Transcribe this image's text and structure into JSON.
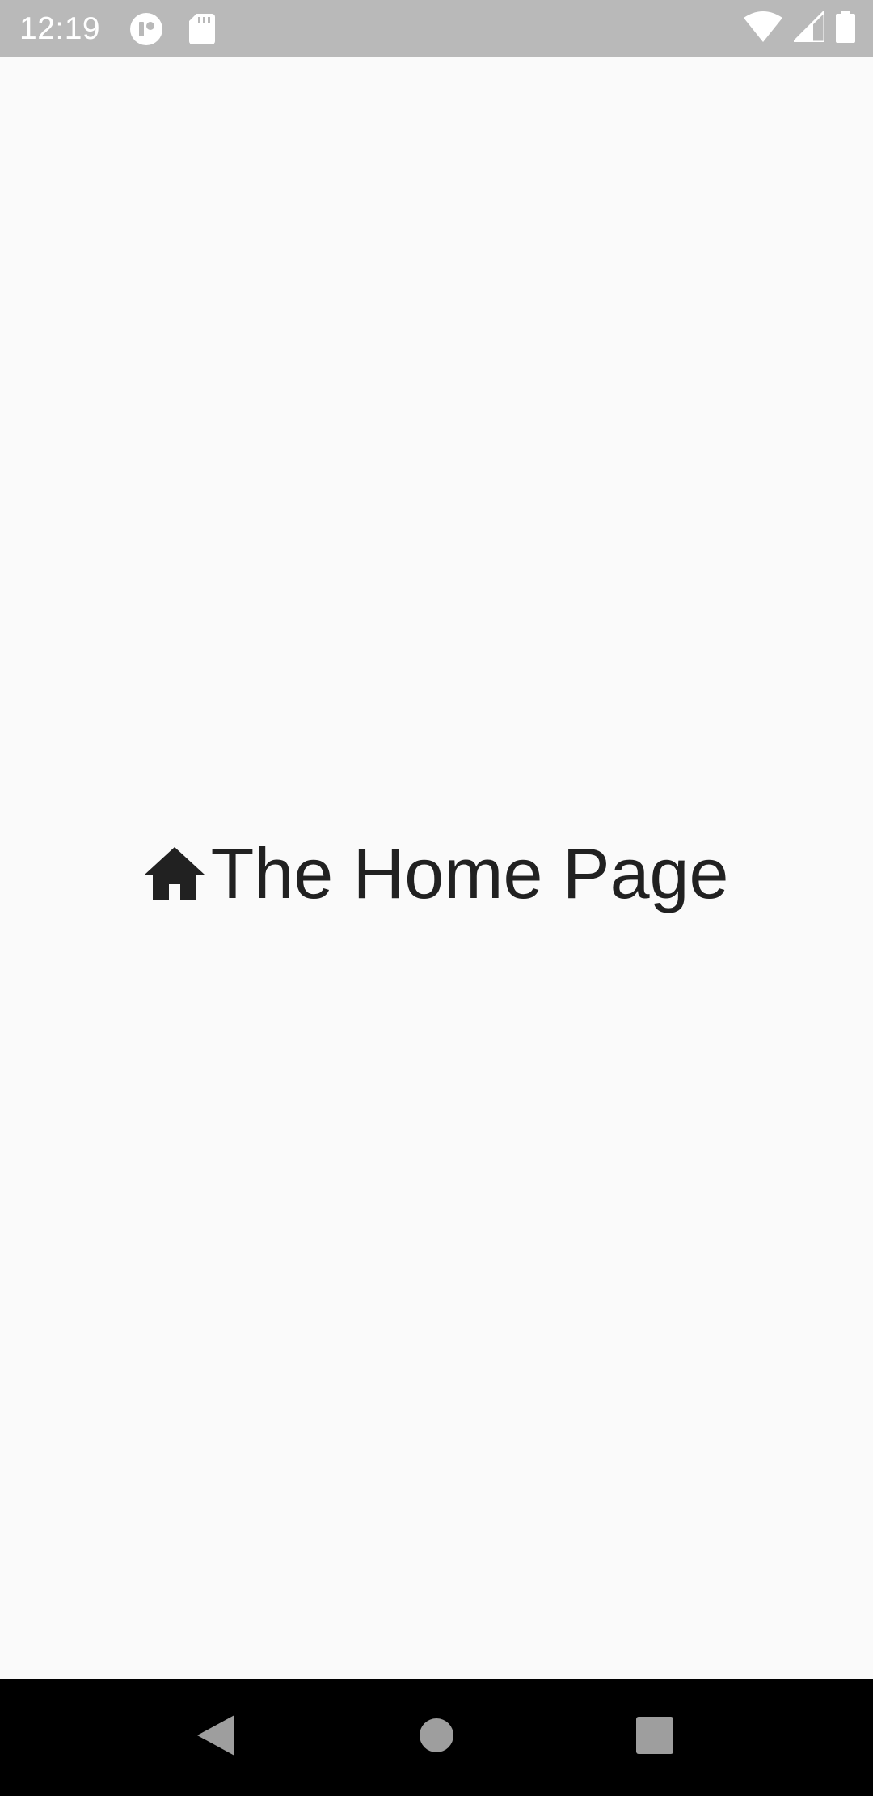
{
  "status_bar": {
    "time": "12:19",
    "left_icons": [
      "app-notification-icon",
      "sd-card-icon"
    ],
    "right_icons": [
      "wifi-icon",
      "cellular-signal-icon",
      "battery-icon"
    ],
    "background_color": "#b9b9b9"
  },
  "main": {
    "icon": "home-icon",
    "title": "The Home Page",
    "text_color": "#212121",
    "background_color": "#fafafa"
  },
  "nav_bar": {
    "buttons": [
      "back-icon",
      "home-circle-icon",
      "recents-icon"
    ],
    "background_color": "#000000"
  }
}
